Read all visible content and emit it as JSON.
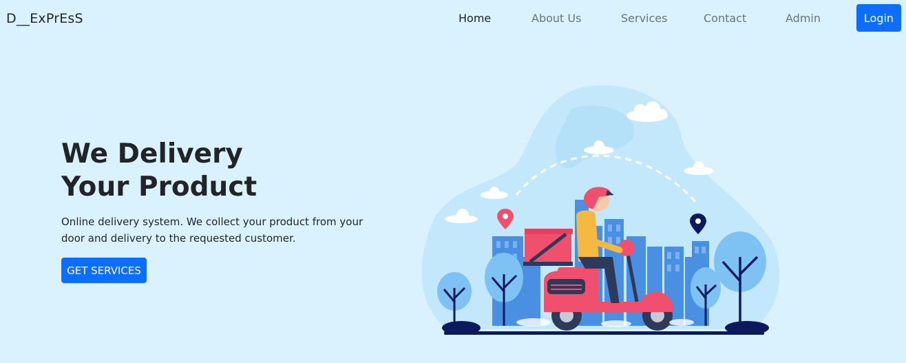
{
  "navbar": {
    "brand": "D__ExPrEsS",
    "links": [
      {
        "label": "Home",
        "active": true
      },
      {
        "label": "About Us",
        "active": false
      },
      {
        "label": "Services",
        "active": false
      },
      {
        "label": "Contact",
        "active": false
      },
      {
        "label": "Admin",
        "active": false
      }
    ],
    "login_label": "Login"
  },
  "hero": {
    "title_line1": "We Delivery",
    "title_line2": "Your Product",
    "description": "Online delivery system. We collect your product from your door and delivery to the requested customer.",
    "cta_label": "GET SERVICES"
  },
  "colors": {
    "background": "#daf2fd",
    "primary": "#0d6efd",
    "accent_pink": "#f0506e",
    "city_blue": "#4a90e2"
  },
  "illustration": {
    "icon": "delivery-scooter-illustration"
  }
}
